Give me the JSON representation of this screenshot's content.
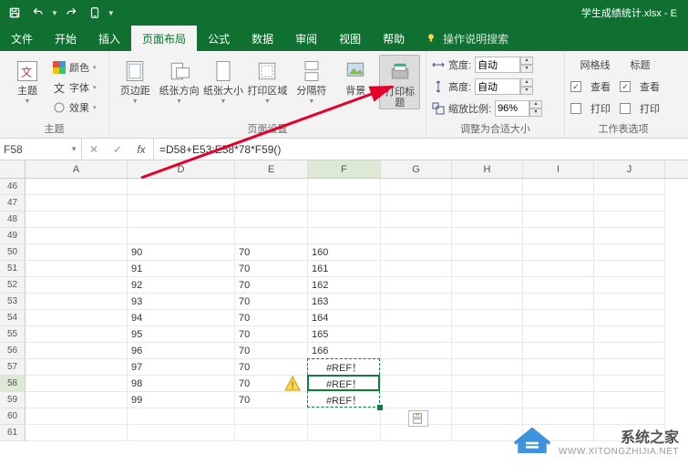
{
  "titlebar": {
    "doc_name": "学生成绩统计.xlsx - E"
  },
  "tabs": {
    "file": "文件",
    "home": "开始",
    "insert": "插入",
    "layout": "页面布局",
    "formulas": "公式",
    "data": "数据",
    "review": "审阅",
    "view": "视图",
    "help": "帮助",
    "tellme": "操作说明搜索"
  },
  "ribbon": {
    "themes": {
      "label": "主题",
      "colors": "颜色",
      "fonts": "字体",
      "effects": "效果",
      "group": "主题"
    },
    "page_setup": {
      "margins": "页边距",
      "orientation": "纸张方向",
      "size": "纸张大小",
      "print_area": "打印区域",
      "breaks": "分隔符",
      "background": "背景",
      "print_titles": "打印标题",
      "group": "页面设置"
    },
    "scale": {
      "width_label": "宽度:",
      "width_value": "自动",
      "height_label": "高度:",
      "height_value": "自动",
      "scale_label": "缩放比例:",
      "scale_value": "96%",
      "group": "调整为合适大小"
    },
    "sheet_options": {
      "gridlines": "网格线",
      "headings": "标题",
      "view": "查看",
      "print": "打印",
      "group": "工作表选项"
    }
  },
  "formula_bar": {
    "name": "F58",
    "formula": "=D58+E53:E58*78*F59()"
  },
  "columns": [
    "A",
    "D",
    "E",
    "F",
    "G",
    "H",
    "I",
    "J"
  ],
  "col_widths": {
    "A": 112,
    "D": 118,
    "E": 80,
    "F": 80,
    "G": 78,
    "H": 78,
    "I": 78,
    "J": 78
  },
  "rows": [
    {
      "r": 46,
      "D": "",
      "E": "",
      "F": ""
    },
    {
      "r": 47,
      "D": "",
      "E": "",
      "F": ""
    },
    {
      "r": 48,
      "D": "",
      "E": "",
      "F": ""
    },
    {
      "r": 49,
      "D": "",
      "E": "",
      "F": ""
    },
    {
      "r": 50,
      "D": "90",
      "E": "70",
      "F": "160"
    },
    {
      "r": 51,
      "D": "91",
      "E": "70",
      "F": "161"
    },
    {
      "r": 52,
      "D": "92",
      "E": "70",
      "F": "162"
    },
    {
      "r": 53,
      "D": "93",
      "E": "70",
      "F": "163"
    },
    {
      "r": 54,
      "D": "94",
      "E": "70",
      "F": "164"
    },
    {
      "r": 55,
      "D": "95",
      "E": "70",
      "F": "165"
    },
    {
      "r": 56,
      "D": "96",
      "E": "70",
      "F": "166"
    },
    {
      "r": 57,
      "D": "97",
      "E": "70",
      "F": "#REF！",
      "Falign": "center"
    },
    {
      "r": 58,
      "D": "98",
      "E": "70",
      "F": "#REF！",
      "Falign": "center",
      "selected": true
    },
    {
      "r": 59,
      "D": "99",
      "E": "70",
      "F": "#REF！",
      "Falign": "center"
    },
    {
      "r": 60,
      "D": "",
      "E": "",
      "F": ""
    },
    {
      "r": 61,
      "D": "",
      "E": "",
      "F": ""
    }
  ],
  "selected_cell": "F58",
  "watermark": {
    "cn": "系统之家",
    "url": "WWW.XITONGZHIJIA.NET"
  }
}
